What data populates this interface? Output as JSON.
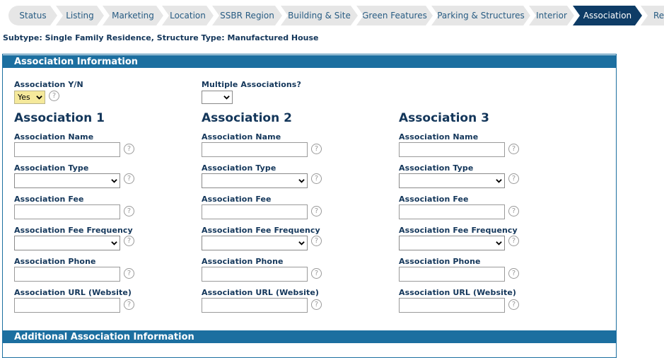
{
  "tabs": [
    {
      "label": "Status"
    },
    {
      "label": "Listing"
    },
    {
      "label": "Marketing"
    },
    {
      "label": "Location"
    },
    {
      "label": "SSBR Region"
    },
    {
      "label": "Building & Site"
    },
    {
      "label": "Green Features"
    },
    {
      "label": "Parking & Structures"
    },
    {
      "label": "Interior"
    },
    {
      "label": "Association"
    },
    {
      "label": "Remar"
    }
  ],
  "subtype": "Subtype: Single Family Residence, Structure Type: Manufactured House",
  "section1": {
    "title": "Association Information"
  },
  "section2": {
    "title": "Additional Association Information"
  },
  "assoc_yn": {
    "label": "Association Y/N",
    "value": "Yes"
  },
  "multi": {
    "label": "Multiple Associations?",
    "value": ""
  },
  "help_glyph": "?",
  "columns": [
    {
      "heading": "Association 1"
    },
    {
      "heading": "Association 2"
    },
    {
      "heading": "Association 3"
    }
  ],
  "fields": {
    "name": "Association Name",
    "type": "Association Type",
    "fee": "Association Fee",
    "freq": "Association Fee Frequency",
    "phone": "Association Phone",
    "url": "Association URL (Website)"
  }
}
